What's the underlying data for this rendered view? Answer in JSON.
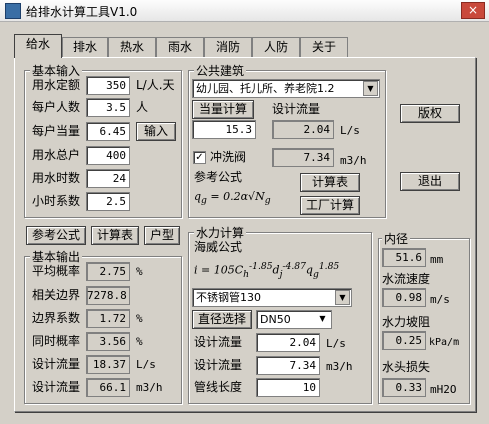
{
  "window": {
    "title": "给排水计算工具V1.0",
    "close_label": "×"
  },
  "tabs": [
    "给水",
    "排水",
    "热水",
    "雨水",
    "消防",
    "人防",
    "关于"
  ],
  "basic_input": {
    "title": "基本输入",
    "rows": [
      {
        "label": "用水定额",
        "value": "350",
        "unit": "L/人.天"
      },
      {
        "label": "每户人数",
        "value": "3.5",
        "unit": "人"
      },
      {
        "label": "每户当量",
        "value": "6.45",
        "unit": ""
      },
      {
        "label": "用水总户",
        "value": "400",
        "unit": ""
      },
      {
        "label": "用水时数",
        "value": "24",
        "unit": ""
      },
      {
        "label": "小时系数",
        "value": "2.5",
        "unit": ""
      }
    ],
    "input_button": "输入"
  },
  "public_building": {
    "title": "公共建筑",
    "selected": "幼儿园、托儿所、养老院1.2",
    "equiv_button": "当量计算",
    "design_flow_label": "设计流量",
    "equiv_value": "15.3",
    "flow_value": "2.04",
    "flow_unit": "L/s",
    "flush_label": "冲洗阀",
    "flush_checked": true,
    "flush_value": "7.34",
    "flush_unit": "m3/h",
    "formula_label": "参考公式",
    "calc_table_button": "计算表",
    "factory_button": "工厂计算"
  },
  "side_buttons": {
    "copyright": "版权",
    "exit": "退出"
  },
  "mid_buttons": {
    "formula": "参考公式",
    "calc_table": "计算表",
    "household": "户型"
  },
  "basic_output": {
    "title": "基本输出",
    "rows": [
      {
        "label": "平均概率",
        "value": "2.75",
        "unit": "%"
      },
      {
        "label": "相关边界",
        "value": "7278.8",
        "unit": ""
      },
      {
        "label": "边界系数",
        "value": "1.72",
        "unit": "%"
      },
      {
        "label": "同时概率",
        "value": "3.56",
        "unit": "%"
      },
      {
        "label": "设计流量",
        "value": "18.37",
        "unit": "L/s"
      },
      {
        "label": "设计流量",
        "value": "66.1",
        "unit": "m3/h"
      }
    ]
  },
  "hydraulic": {
    "title": "水力计算",
    "formula_label": "海威公式",
    "pipe_material": "不锈钢管130",
    "diameter_button": "直径选择",
    "dn": "DN50",
    "rows": [
      {
        "label": "设计流量",
        "value": "2.04",
        "unit": "L/s"
      },
      {
        "label": "设计流量",
        "value": "7.34",
        "unit": "m3/h"
      },
      {
        "label": "管线长度",
        "value": "10",
        "unit": ""
      }
    ]
  },
  "results": {
    "inner_diameter": {
      "label": "内径",
      "value": "51.6",
      "unit": "mm"
    },
    "velocity": {
      "label": "水流速度",
      "value": "0.98",
      "unit": "m/s"
    },
    "gradient": {
      "label": "水力坡阻",
      "value": "0.25",
      "unit": "kPa/m"
    },
    "head_loss": {
      "label": "水头损失",
      "value": "0.33",
      "unit": "mH2O"
    }
  },
  "colors": {
    "face": "#d4d0c8",
    "field": "#ffffff",
    "close": "#c9493b"
  }
}
